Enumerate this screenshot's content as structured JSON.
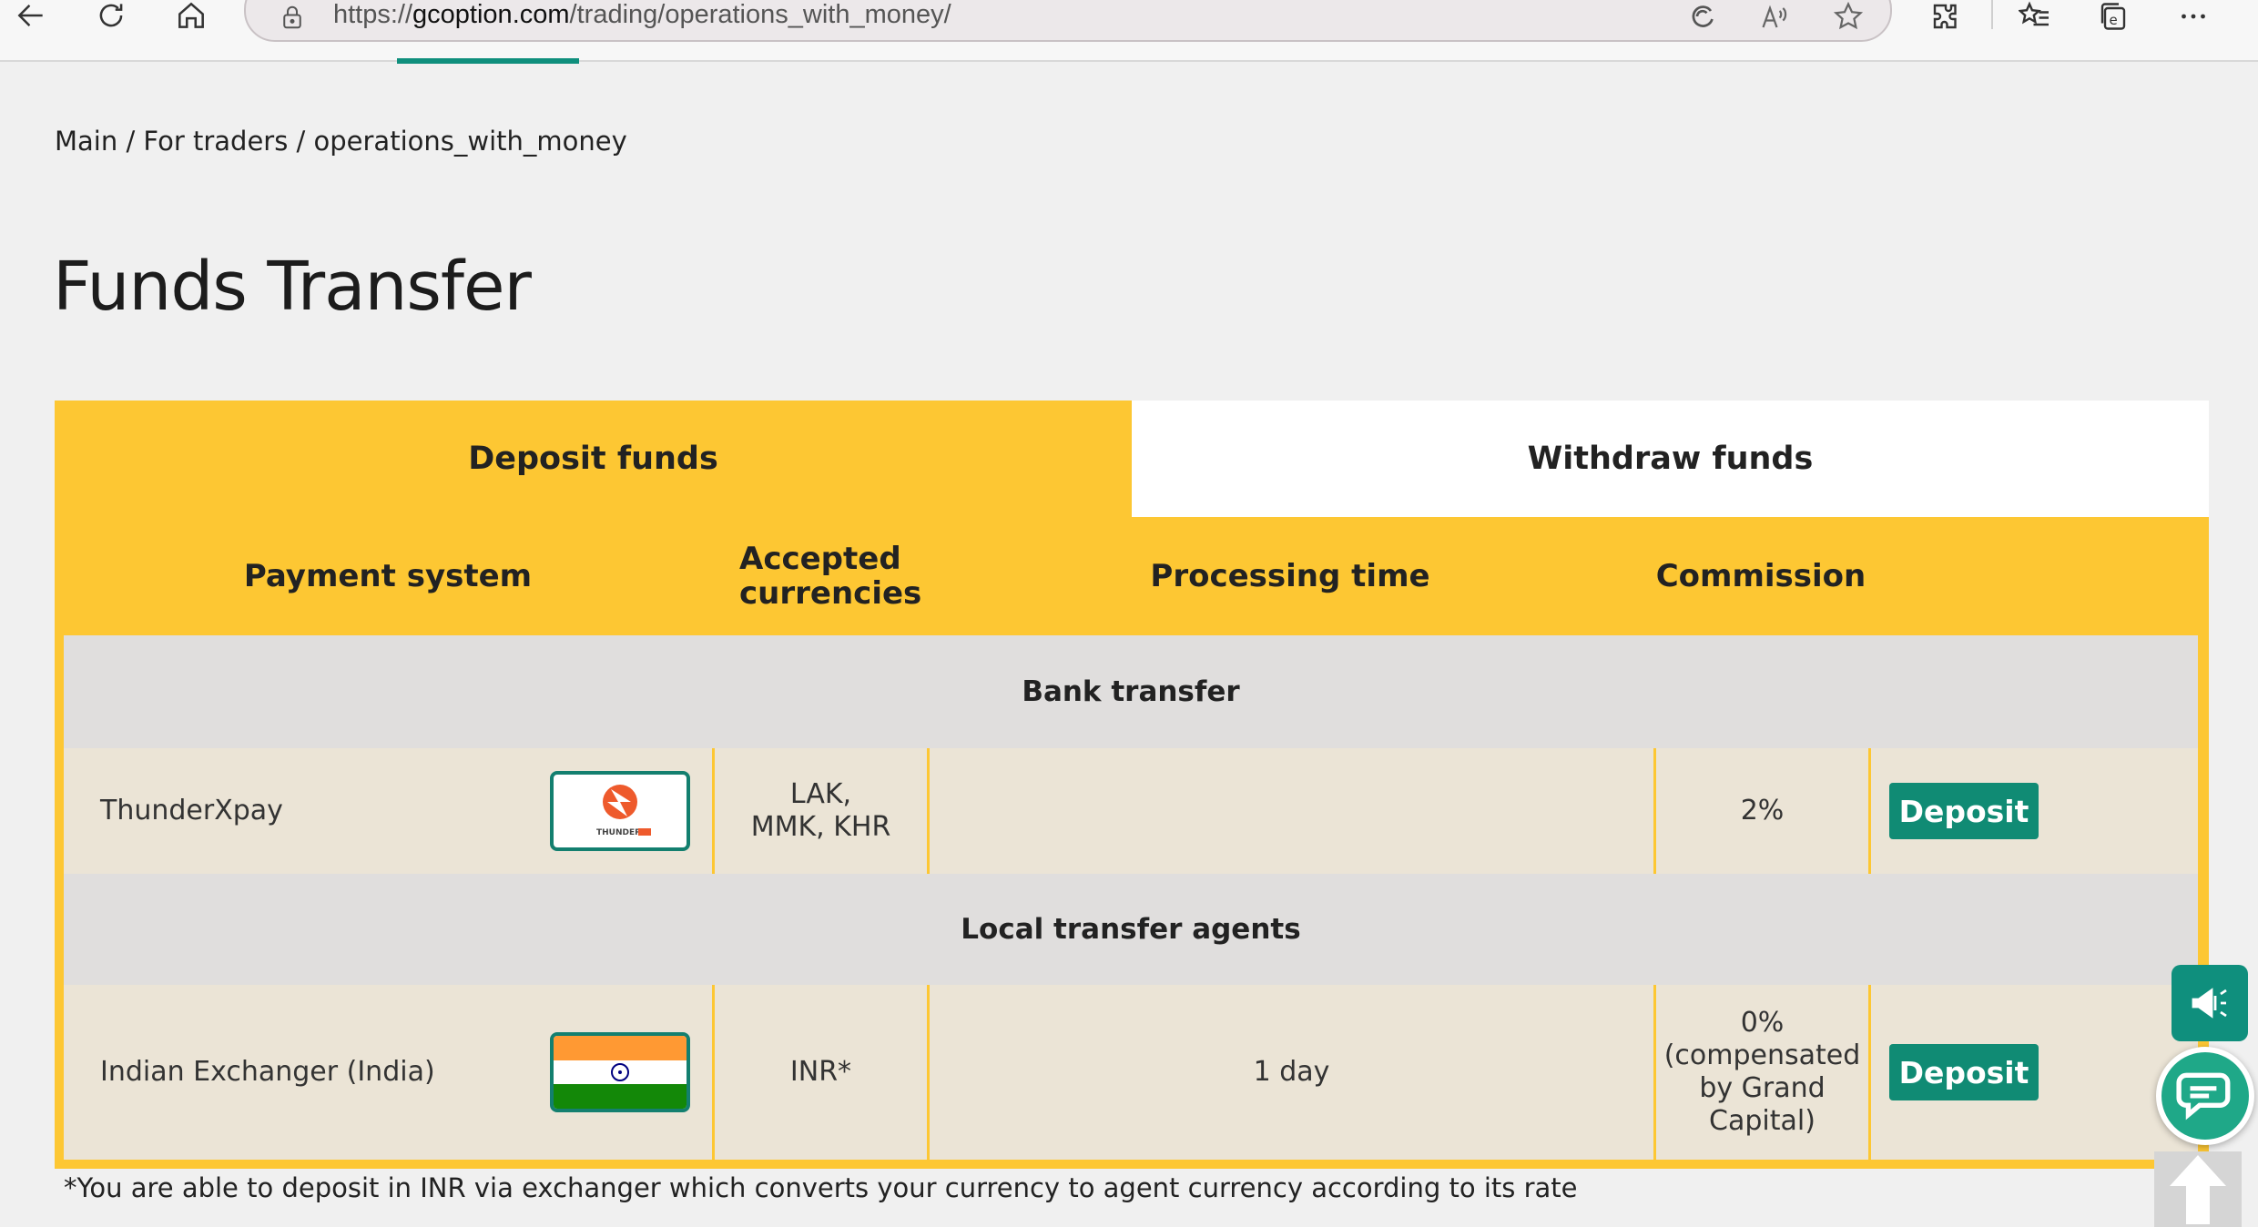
{
  "browser": {
    "url_prefix": "https://",
    "url_domain": "gcoption.com",
    "url_path": "/trading/operations_with_money/"
  },
  "breadcrumb": "Main / For traders / operations_with_money",
  "page_title": "Funds Transfer",
  "tabs": [
    {
      "label": "Deposit funds",
      "active": true
    },
    {
      "label": "Withdraw funds",
      "active": false
    }
  ],
  "table": {
    "headers": [
      "Payment system",
      "Accepted currencies",
      "Processing time",
      "Commission"
    ],
    "sections": [
      {
        "title": "Bank transfer",
        "rows": [
          {
            "name": "ThunderXpay",
            "logo": "thunderxpay-logo",
            "currencies": "LAK, MMK, KHR",
            "time": "",
            "commission": "2%",
            "action": "Deposit"
          }
        ]
      },
      {
        "title": "Local transfer agents",
        "rows": [
          {
            "name": "Indian Exchanger (India)",
            "logo": "india-flag",
            "currencies": "INR*",
            "time": "1 day",
            "commission": "0% (compensated by Grand Capital)",
            "action": "Deposit"
          }
        ]
      }
    ]
  },
  "footnote": "*You are able to deposit in INR via exchanger which converts your currency to agent currency according to its rate",
  "logo_text": "THUNDERX",
  "colors": {
    "accent_yellow": "#fdc733",
    "brand_green": "#108b74",
    "row_bg": "#ebe4d6",
    "section_bg": "#e0dedd"
  }
}
